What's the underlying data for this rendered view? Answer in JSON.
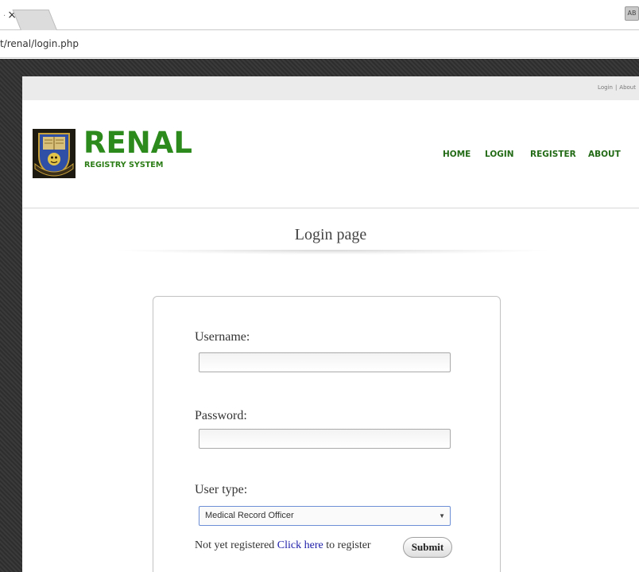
{
  "browser": {
    "tab_close_glyph": "×",
    "url": "t/renal/login.php",
    "extension_label": "AB"
  },
  "site": {
    "top_links": {
      "login": "Login",
      "separator": "|",
      "about": "About"
    },
    "brand": {
      "title": "RENAL",
      "subtitle": "REGISTRY SYSTEM"
    },
    "nav": {
      "home": "HOME",
      "login": "LOGIN",
      "register": "REGISTER",
      "about": "ABOUT"
    },
    "colors": {
      "brand_green": "#2c8a1c",
      "nav_green": "#236b16",
      "link_blue": "#1c1ca8"
    }
  },
  "login_page": {
    "heading": "Login page",
    "username": {
      "label": "Username:",
      "value": "",
      "placeholder": ""
    },
    "password": {
      "label": "Password:",
      "value": "",
      "placeholder": ""
    },
    "user_type": {
      "label": "User type:",
      "selected": "Medical Record Officer",
      "arrow": "▼"
    },
    "register": {
      "prefix": "Not yet registered ",
      "link": "Click here",
      "suffix": " to register"
    },
    "submit_label": "Submit"
  }
}
